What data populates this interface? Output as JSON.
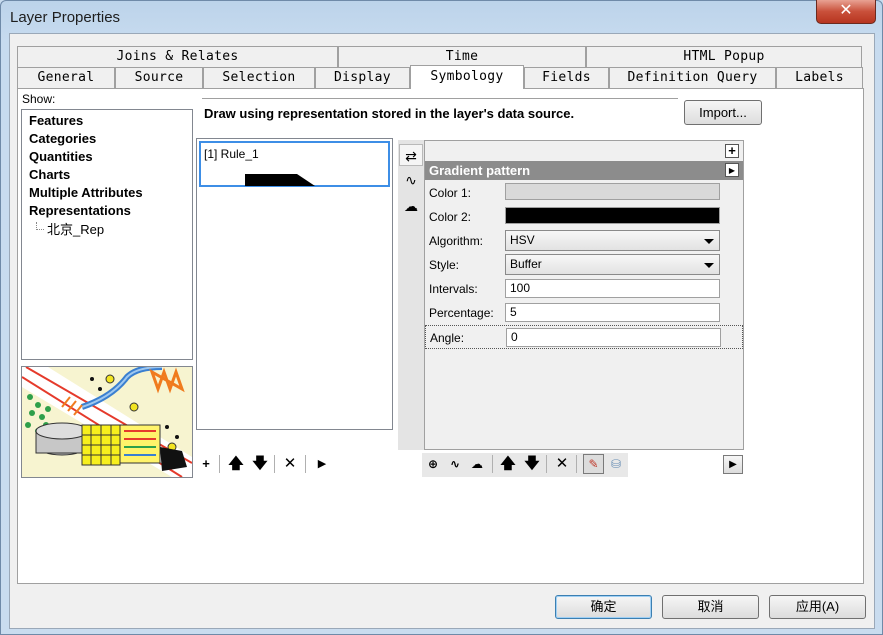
{
  "window": {
    "title": "Layer Properties",
    "close_glyph": "✕"
  },
  "tabs": {
    "row1": [
      "Joins & Relates",
      "Time",
      "HTML Popup"
    ],
    "row2": [
      "General",
      "Source",
      "Selection",
      "Display",
      "Symbology",
      "Fields",
      "Definition Query",
      "Labels"
    ],
    "active": "Symbology"
  },
  "show": {
    "label": "Show:",
    "items": [
      "Features",
      "Categories",
      "Quantities",
      "Charts",
      "Multiple Attributes",
      "Representations"
    ],
    "sub_item": "北京_Rep"
  },
  "description": "Draw using representation stored in the layer's data source.",
  "import_button": "Import...",
  "rules": {
    "items": [
      "[1] Rule_1"
    ]
  },
  "properties": {
    "header": "Gradient pattern",
    "add_glyph": "+",
    "menu_glyph": "▶",
    "color1_label": "Color 1:",
    "color1": "#d9d9d9",
    "color2_label": "Color 2:",
    "color2": "#000000",
    "algorithm_label": "Algorithm:",
    "algorithm": "HSV",
    "style_label": "Style:",
    "style": "Buffer",
    "intervals_label": "Intervals:",
    "intervals": "100",
    "percentage_label": "Percentage:",
    "percentage": "5",
    "angle_label": "Angle:",
    "angle": "0"
  },
  "rule_toolbar": {
    "add": "+",
    "up": "🡅",
    "down": "🡇",
    "delete": "✕",
    "next": "▶"
  },
  "layer_toolbar": {
    "up": "🡅",
    "down": "🡇",
    "delete": "✕",
    "next": "▶"
  },
  "dialog": {
    "ok": "确定",
    "cancel": "取消",
    "apply": "应用(A)"
  }
}
